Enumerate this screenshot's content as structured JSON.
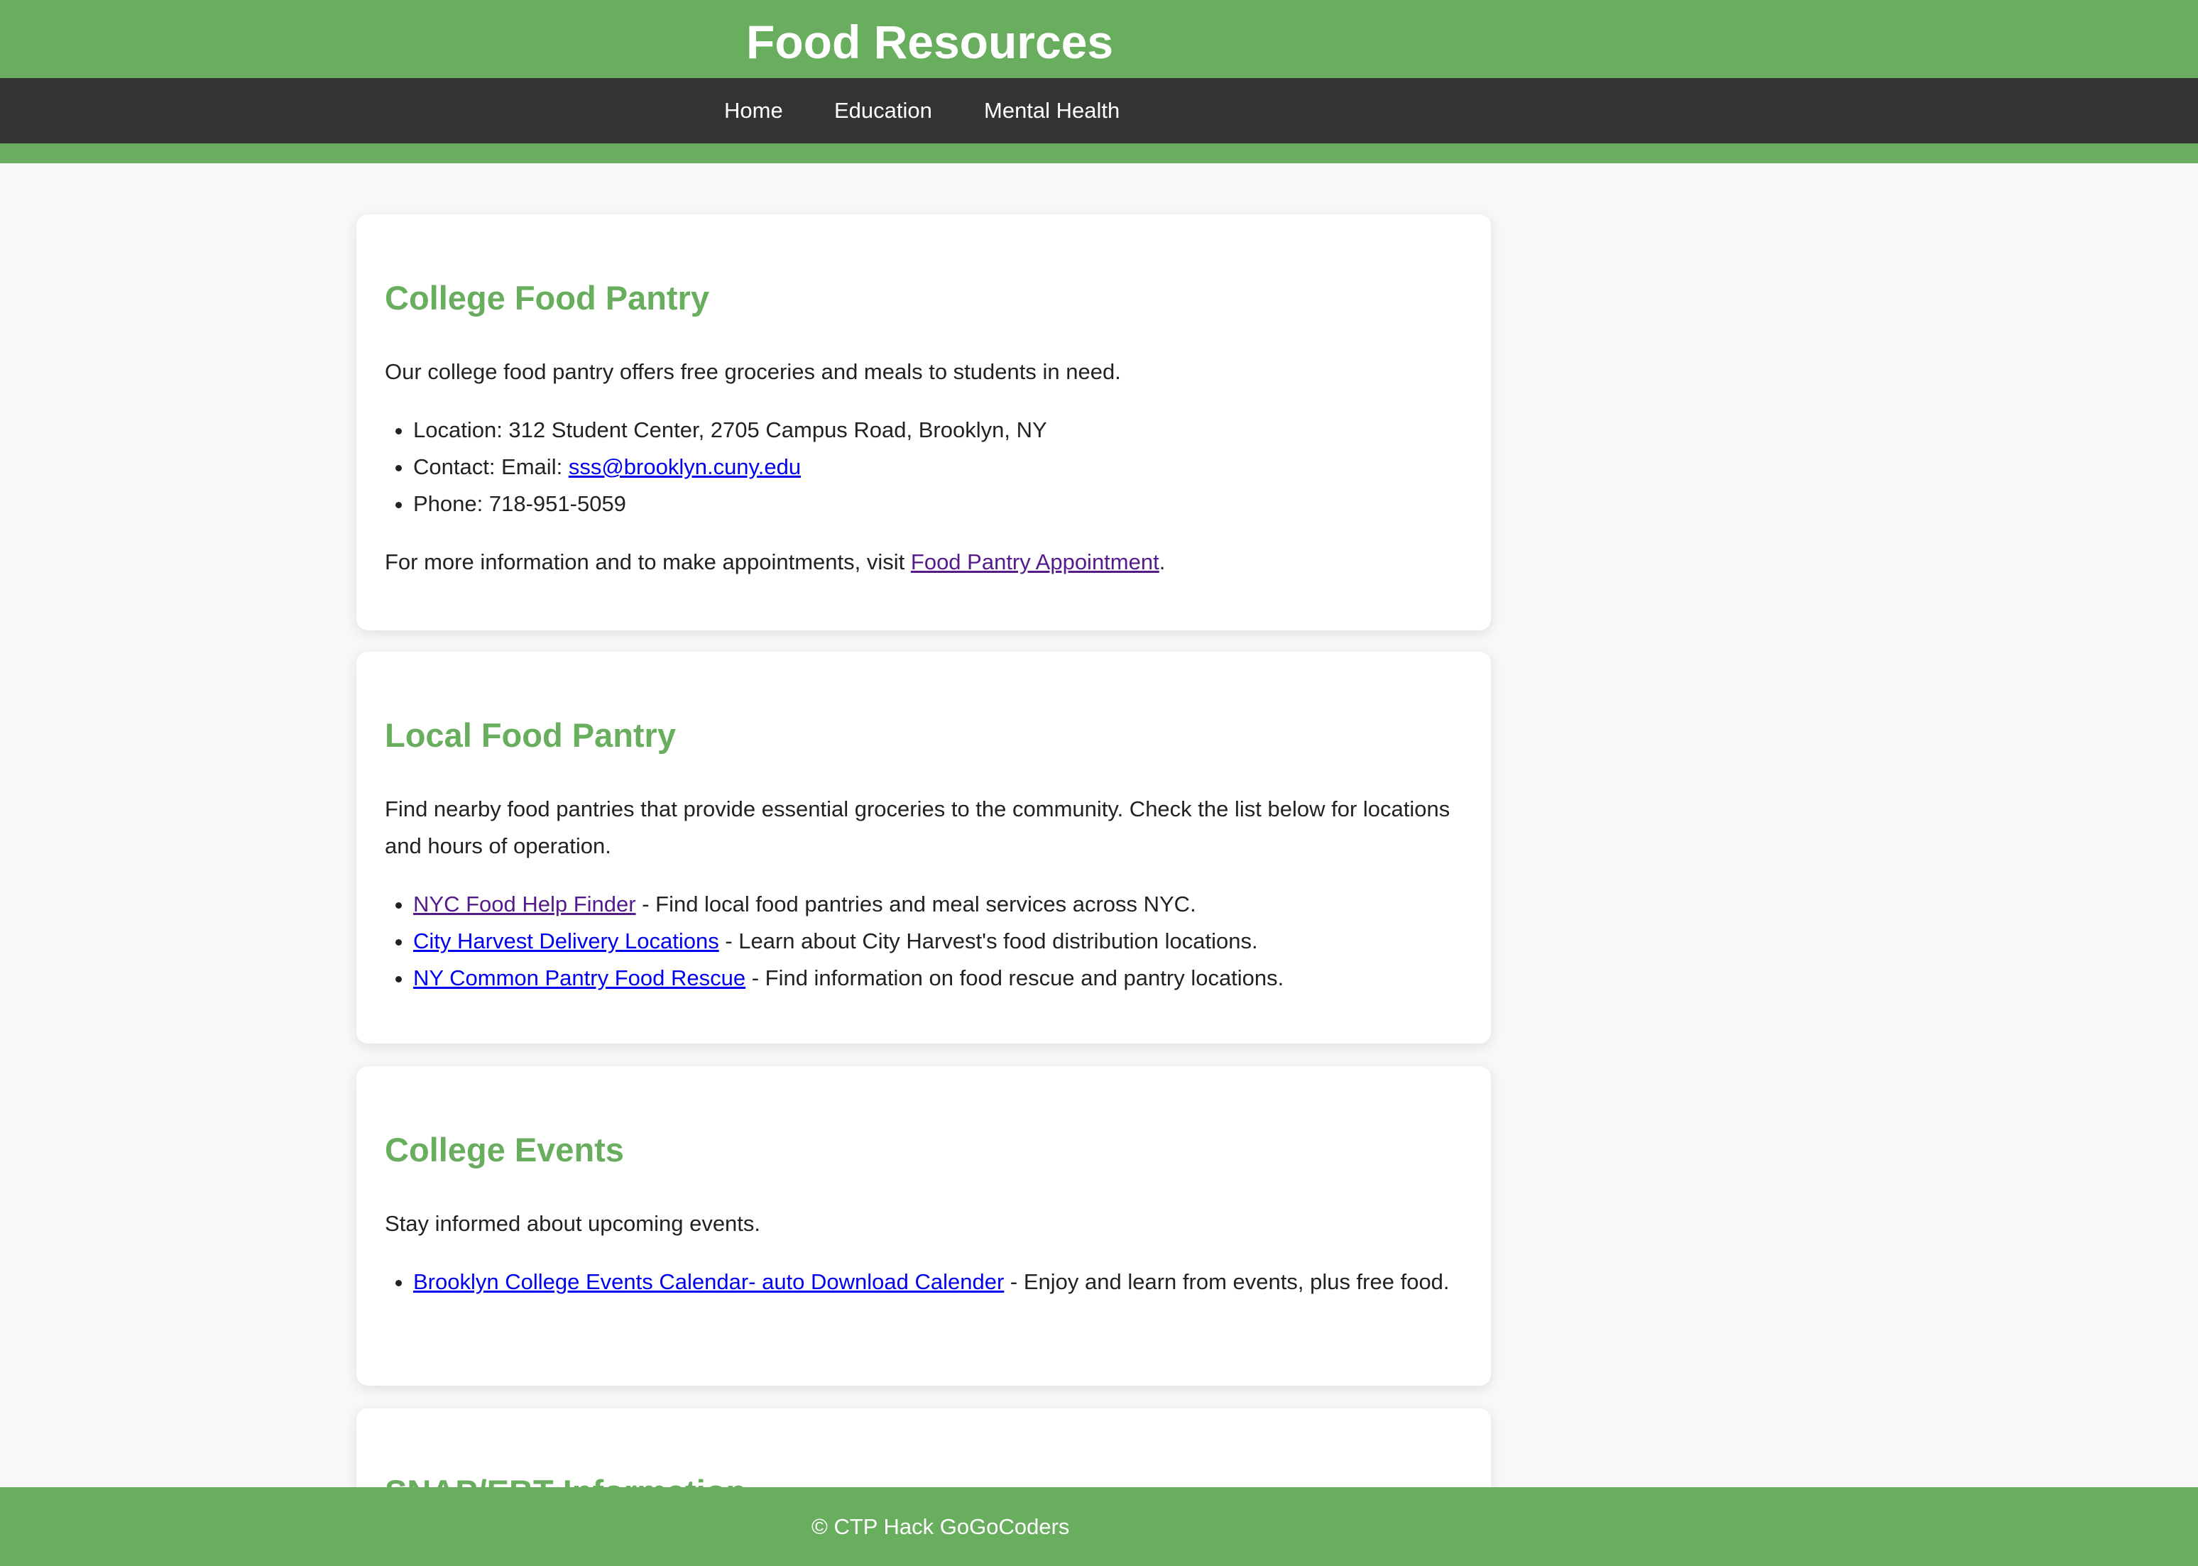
{
  "header": {
    "title": "Food Resources",
    "nav": [
      {
        "label": "Home"
      },
      {
        "label": "Education"
      },
      {
        "label": "Mental Health"
      }
    ]
  },
  "sections": {
    "college_pantry": {
      "heading": "College Food Pantry",
      "intro": "Our college food pantry offers free groceries and meals to students in need.",
      "location": "Location: 312 Student Center, 2705 Campus Road, Brooklyn, NY",
      "contact_prefix": "Contact: Email: ",
      "contact_email": "sss@brooklyn.cuny.edu",
      "phone": "Phone: 718-951-5059",
      "more_prefix": "For more information and to make appointments, visit ",
      "more_link": "Food Pantry Appointment",
      "more_suffix": "."
    },
    "local_pantry": {
      "heading": "Local Food Pantry",
      "intro": "Find nearby food pantries that provide essential groceries to the community. Check the list below for locations and hours of operation.",
      "items": [
        {
          "link": "NYC Food Help Finder",
          "text": " - Find local food pantries and meal services across NYC."
        },
        {
          "link": "City Harvest Delivery Locations",
          "text": " - Learn about City Harvest's food distribution locations."
        },
        {
          "link": "NY Common Pantry Food Rescue",
          "text": " - Find information on food rescue and pantry locations."
        }
      ]
    },
    "college_events": {
      "heading": "College Events",
      "intro": "Stay informed about upcoming events.",
      "items": [
        {
          "link": "Brooklyn College Events Calendar- auto Download Calender",
          "text": " - Enjoy and learn from events, plus free food."
        }
      ]
    },
    "snap": {
      "heading": "SNAP/EBT Information"
    }
  },
  "footer": {
    "text": "© CTP Hack GoGoCoders"
  },
  "colors": {
    "brand_green": "#68ae5e",
    "nav_dark": "#333333",
    "link_blue": "#0000ee",
    "link_visited": "#551a8b",
    "page_background": "#f8f8f8"
  }
}
